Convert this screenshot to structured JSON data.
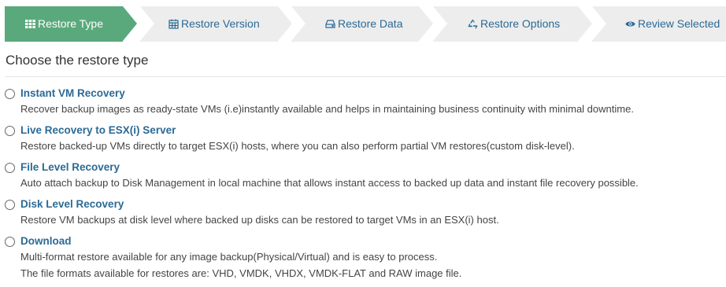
{
  "wizard": {
    "steps": [
      {
        "label": "Restore Type",
        "icon": "grid-icon",
        "active": true
      },
      {
        "label": "Restore Version",
        "icon": "calendar-icon",
        "active": false
      },
      {
        "label": "Restore Data",
        "icon": "hard-drive-icon",
        "active": false
      },
      {
        "label": "Restore Options",
        "icon": "recycle-icon",
        "active": false
      },
      {
        "label": "Review Selected",
        "icon": "eye-icon",
        "active": false
      }
    ]
  },
  "page": {
    "title": "Choose the restore type"
  },
  "options": [
    {
      "title": "Instant VM Recovery",
      "desc": [
        "Recover backup images as ready-state VMs (i.e)instantly available and helps in maintaining business continuity with minimal downtime."
      ]
    },
    {
      "title": "Live Recovery to ESX(i) Server",
      "desc": [
        "Restore backed-up VMs directly to target ESX(i) hosts, where you can also perform partial VM restores(custom disk-level)."
      ]
    },
    {
      "title": "File Level Recovery",
      "desc": [
        "Auto attach backup to Disk Management in local machine that allows instant access to backed up data and instant file recovery possible."
      ]
    },
    {
      "title": "Disk Level Recovery",
      "desc": [
        "Restore VM backups at disk level where backed up disks can be restored to target VMs in an ESX(i) host."
      ]
    },
    {
      "title": "Download",
      "desc": [
        "Multi-format restore available for any image backup(Physical/Virtual) and is easy to process.",
        "The file formats available for restores are: VHD, VMDK, VHDX, VMDK-FLAT and RAW image file."
      ]
    }
  ],
  "colors": {
    "active_step": "#5aa97c",
    "inactive_step": "#ededed",
    "link": "#2b6a95"
  }
}
